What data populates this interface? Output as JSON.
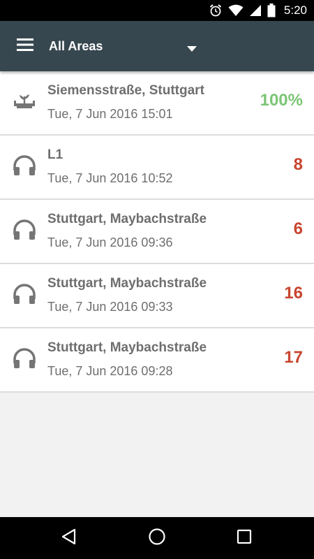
{
  "status_bar": {
    "time": "5:20",
    "icons": [
      "alarm-icon",
      "wifi-icon",
      "cellular-icon",
      "battery-icon"
    ]
  },
  "app_bar": {
    "title": "All Areas",
    "background": "#37474f",
    "icons": [
      "hamburger-menu-icon",
      "dropdown-arrow-icon"
    ]
  },
  "list": {
    "items": [
      {
        "title": "Siemensstraße, Stuttgart",
        "subtitle": "Tue, 7 Jun 2016 15:01",
        "value": "100%",
        "icon": "plant-bed-icon",
        "value_color": "#7cc576"
      },
      {
        "title": "L1",
        "subtitle": "Tue, 7 Jun 2016 10:52",
        "value": "8",
        "icon": "headphones-icon",
        "value_color": "#c8452f"
      },
      {
        "title": "Stuttgart, Maybachstraße",
        "subtitle": "Tue, 7 Jun 2016 09:36",
        "value": "6",
        "icon": "headphones-icon",
        "value_color": "#c8452f"
      },
      {
        "title": "Stuttgart, Maybachstraße",
        "subtitle": "Tue, 7 Jun 2016 09:33",
        "value": "16",
        "icon": "headphones-icon",
        "value_color": "#c8452f"
      },
      {
        "title": "Stuttgart, Maybachstraße",
        "subtitle": "Tue, 7 Jun 2016 09:28",
        "value": "17",
        "icon": "headphones-icon",
        "value_color": "#c8452f"
      }
    ]
  },
  "nav_bar": {
    "icons": [
      "back-icon",
      "home-icon",
      "recents-icon"
    ]
  }
}
